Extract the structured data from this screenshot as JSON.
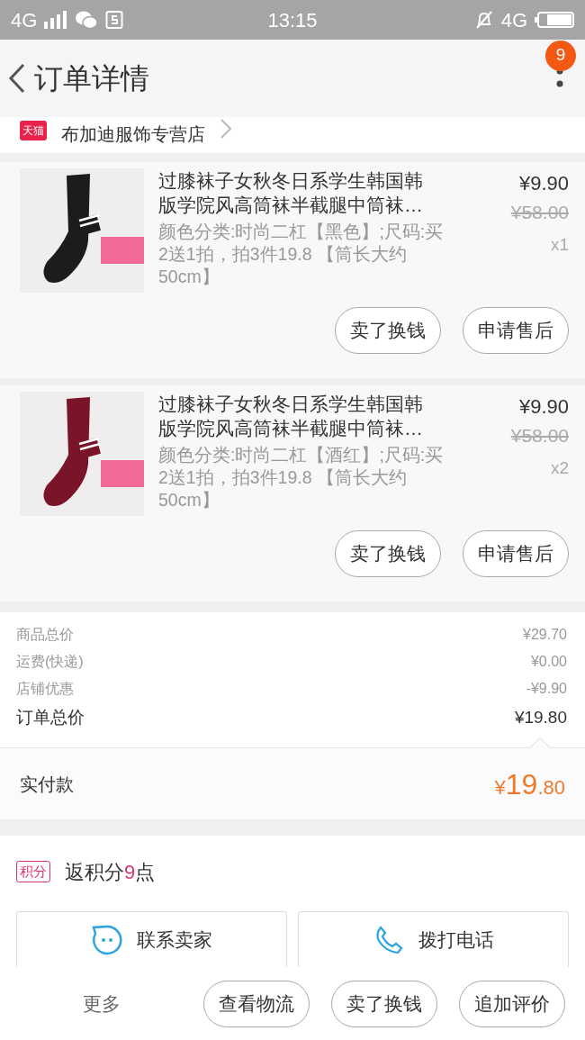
{
  "status_bar": {
    "network_left": "4G",
    "time": "13:15",
    "network_right": "4G"
  },
  "header": {
    "title": "订单详情",
    "badge": "9"
  },
  "shop": {
    "platform_tag": "天猫",
    "name": "布加迪服饰专营店"
  },
  "items": [
    {
      "title": "过膝袜子女秋冬日系学生韩国韩版学院风高筒袜半截腿中筒袜…",
      "spec": "颜色分类:时尚二杠【黑色】;尺码:买2送1拍，拍3件19.8 【筒长大约50cm】",
      "price": "¥9.90",
      "original_price": "¥58.00",
      "quantity": "x1",
      "buttons": [
        "卖了换钱",
        "申请售后"
      ]
    },
    {
      "title": "过膝袜子女秋冬日系学生韩国韩版学院风高筒袜半截腿中筒袜…",
      "spec": "颜色分类:时尚二杠【酒红】;尺码:买2送1拍，拍3件19.8 【筒长大约50cm】",
      "price": "¥9.90",
      "original_price": "¥58.00",
      "quantity": "x2",
      "buttons": [
        "卖了换钱",
        "申请售后"
      ]
    }
  ],
  "summary": [
    {
      "label": "商品总价",
      "value": "¥29.70",
      "kind": "minor"
    },
    {
      "label": "运费(快递)",
      "value": "¥0.00",
      "kind": "minor"
    },
    {
      "label": "店铺优惠",
      "value": "-¥9.90",
      "kind": "minor"
    },
    {
      "label": "订单总价",
      "value": "¥19.80",
      "kind": "total"
    }
  ],
  "payment": {
    "label": "实付款",
    "currency": "¥",
    "integer": "19",
    "decimal": ".80"
  },
  "points": {
    "tag": "积分",
    "prefix": "返积分",
    "value": "9",
    "suffix": "点"
  },
  "contact_buttons": [
    {
      "label": "联系卖家",
      "kind": "chat"
    },
    {
      "label": "拨打电话",
      "kind": "phone"
    }
  ],
  "bottom_bar": {
    "more": "更多",
    "buttons": [
      "查看物流",
      "卖了换钱",
      "追加评价"
    ]
  }
}
